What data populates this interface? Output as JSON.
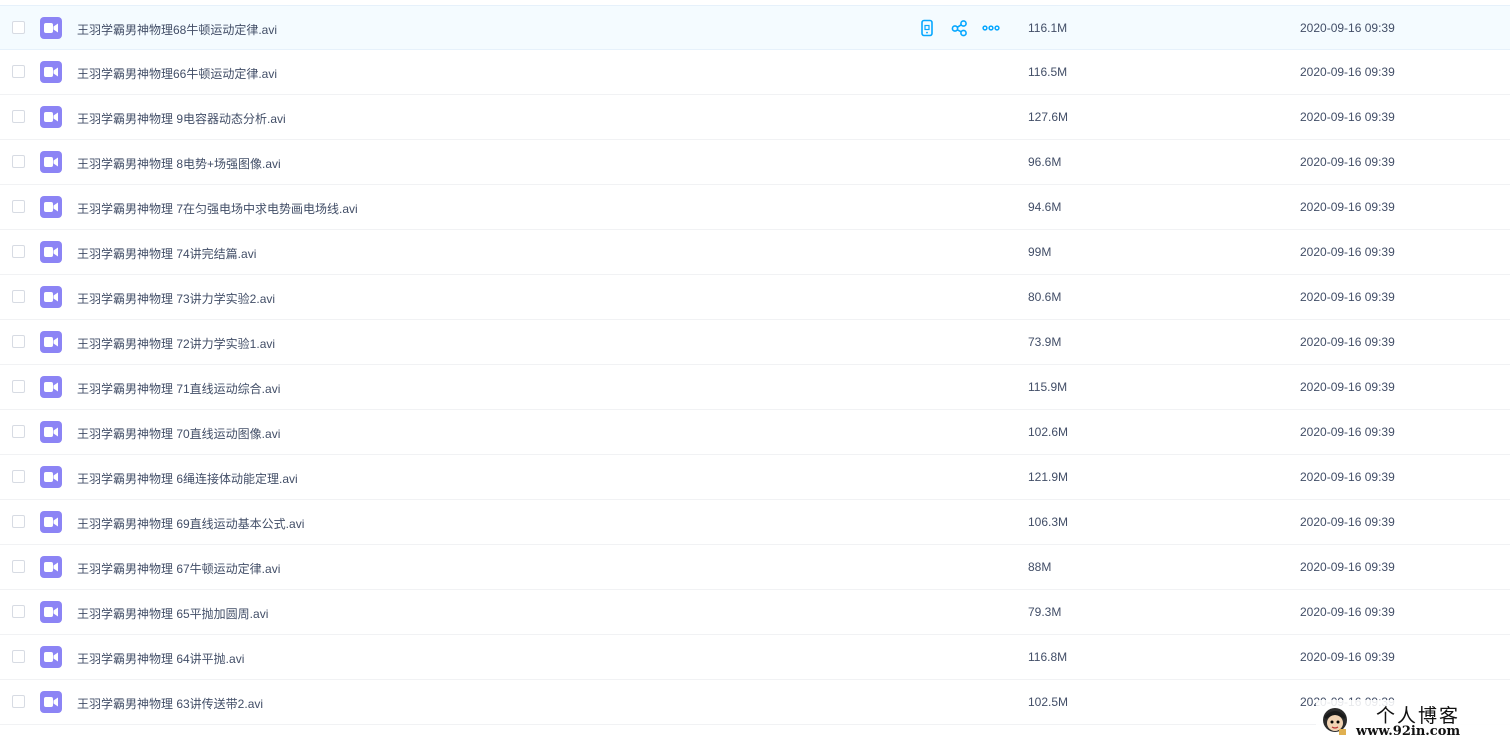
{
  "files": [
    {
      "name": "王羽学霸男神物理68牛顿运动定律.avi",
      "size": "116.1M",
      "date": "2020-09-16 09:39"
    },
    {
      "name": "王羽学霸男神物理66牛顿运动定律.avi",
      "size": "116.5M",
      "date": "2020-09-16 09:39"
    },
    {
      "name": "王羽学霸男神物理 9电容器动态分析.avi",
      "size": "127.6M",
      "date": "2020-09-16 09:39"
    },
    {
      "name": "王羽学霸男神物理 8电势+场强图像.avi",
      "size": "96.6M",
      "date": "2020-09-16 09:39"
    },
    {
      "name": "王羽学霸男神物理 7在匀强电场中求电势画电场线.avi",
      "size": "94.6M",
      "date": "2020-09-16 09:39"
    },
    {
      "name": "王羽学霸男神物理 74讲完结篇.avi",
      "size": "99M",
      "date": "2020-09-16 09:39"
    },
    {
      "name": "王羽学霸男神物理 73讲力学实验2.avi",
      "size": "80.6M",
      "date": "2020-09-16 09:39"
    },
    {
      "name": "王羽学霸男神物理 72讲力学实验1.avi",
      "size": "73.9M",
      "date": "2020-09-16 09:39"
    },
    {
      "name": "王羽学霸男神物理 71直线运动综合.avi",
      "size": "115.9M",
      "date": "2020-09-16 09:39"
    },
    {
      "name": "王羽学霸男神物理 70直线运动图像.avi",
      "size": "102.6M",
      "date": "2020-09-16 09:39"
    },
    {
      "name": "王羽学霸男神物理 6绳连接体动能定理.avi",
      "size": "121.9M",
      "date": "2020-09-16 09:39"
    },
    {
      "name": "王羽学霸男神物理 69直线运动基本公式.avi",
      "size": "106.3M",
      "date": "2020-09-16 09:39"
    },
    {
      "name": "王羽学霸男神物理 67牛顿运动定律.avi",
      "size": "88M",
      "date": "2020-09-16 09:39"
    },
    {
      "name": "王羽学霸男神物理 65平抛加圆周.avi",
      "size": "79.3M",
      "date": "2020-09-16 09:39"
    },
    {
      "name": "王羽学霸男神物理 64讲平抛.avi",
      "size": "116.8M",
      "date": "2020-09-16 09:39"
    },
    {
      "name": "王羽学霸男神物理 63讲传送带2.avi",
      "size": "102.5M",
      "date": "2020-09-16 09:39"
    }
  ],
  "hovered_row_index": 0,
  "row_actions": [
    "phone-icon",
    "share-icon",
    "more-icon"
  ],
  "colors": {
    "accent": "#06a7ff",
    "file_icon": "#8c84f5"
  },
  "watermark": {
    "title": "个人博客",
    "url": "www.92in.com"
  }
}
